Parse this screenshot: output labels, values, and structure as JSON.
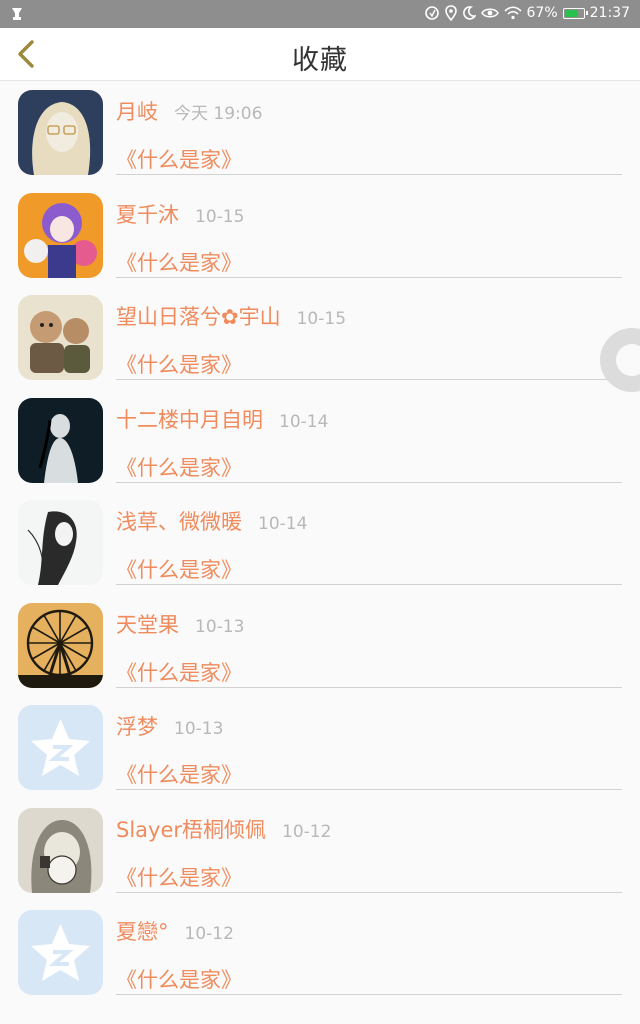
{
  "status_bar": {
    "battery": "67%",
    "time": "21:37",
    "battery_level": 0.67
  },
  "header": {
    "title": "收藏",
    "back_icon": "chevron-left-icon"
  },
  "favorites": [
    {
      "name": "月岐",
      "date": "今天 19:06",
      "book": "《什么是家》",
      "avatar": "portrait-blonde-glasses",
      "colors": [
        "#2e3f5e",
        "#e8dcc0"
      ]
    },
    {
      "name": "夏千沐",
      "date": "10-15",
      "book": "《什么是家》",
      "avatar": "anime-purple-orange",
      "colors": [
        "#f09a2a",
        "#8c5ccf"
      ]
    },
    {
      "name": "望山日落兮✿宇山",
      "date": "10-15",
      "book": "《什么是家》",
      "avatar": "two-toy-kids",
      "colors": [
        "#e9e2cf",
        "#c59b73"
      ]
    },
    {
      "name": "十二楼中月自明",
      "date": "10-14",
      "book": "《什么是家》",
      "avatar": "dark-ink-lady",
      "colors": [
        "#0f1e26",
        "#d8dde0"
      ]
    },
    {
      "name": "浅草、微微暖",
      "date": "10-14",
      "book": "《什么是家》",
      "avatar": "ink-sketch-girl",
      "colors": [
        "#f4f5f5",
        "#2a2a2a"
      ]
    },
    {
      "name": "天堂果",
      "date": "10-13",
      "book": "《什么是家》",
      "avatar": "ferris-wheel",
      "colors": [
        "#e6b15e",
        "#1e1a10"
      ]
    },
    {
      "name": "浮梦",
      "date": "10-13",
      "book": "《什么是家》",
      "avatar": "default-qq-star",
      "colors": [
        "#d8e7f6",
        "#ffffff"
      ]
    },
    {
      "name": "Slayer梧桐倾佩",
      "date": "10-12",
      "book": "《什么是家》",
      "avatar": "hooded-sketch",
      "colors": [
        "#ddd9cf",
        "#3a3630"
      ]
    },
    {
      "name": "夏戀°",
      "date": "10-12",
      "book": "《什么是家》",
      "avatar": "default-qq-star",
      "colors": [
        "#d8e7f6",
        "#ffffff"
      ]
    }
  ]
}
